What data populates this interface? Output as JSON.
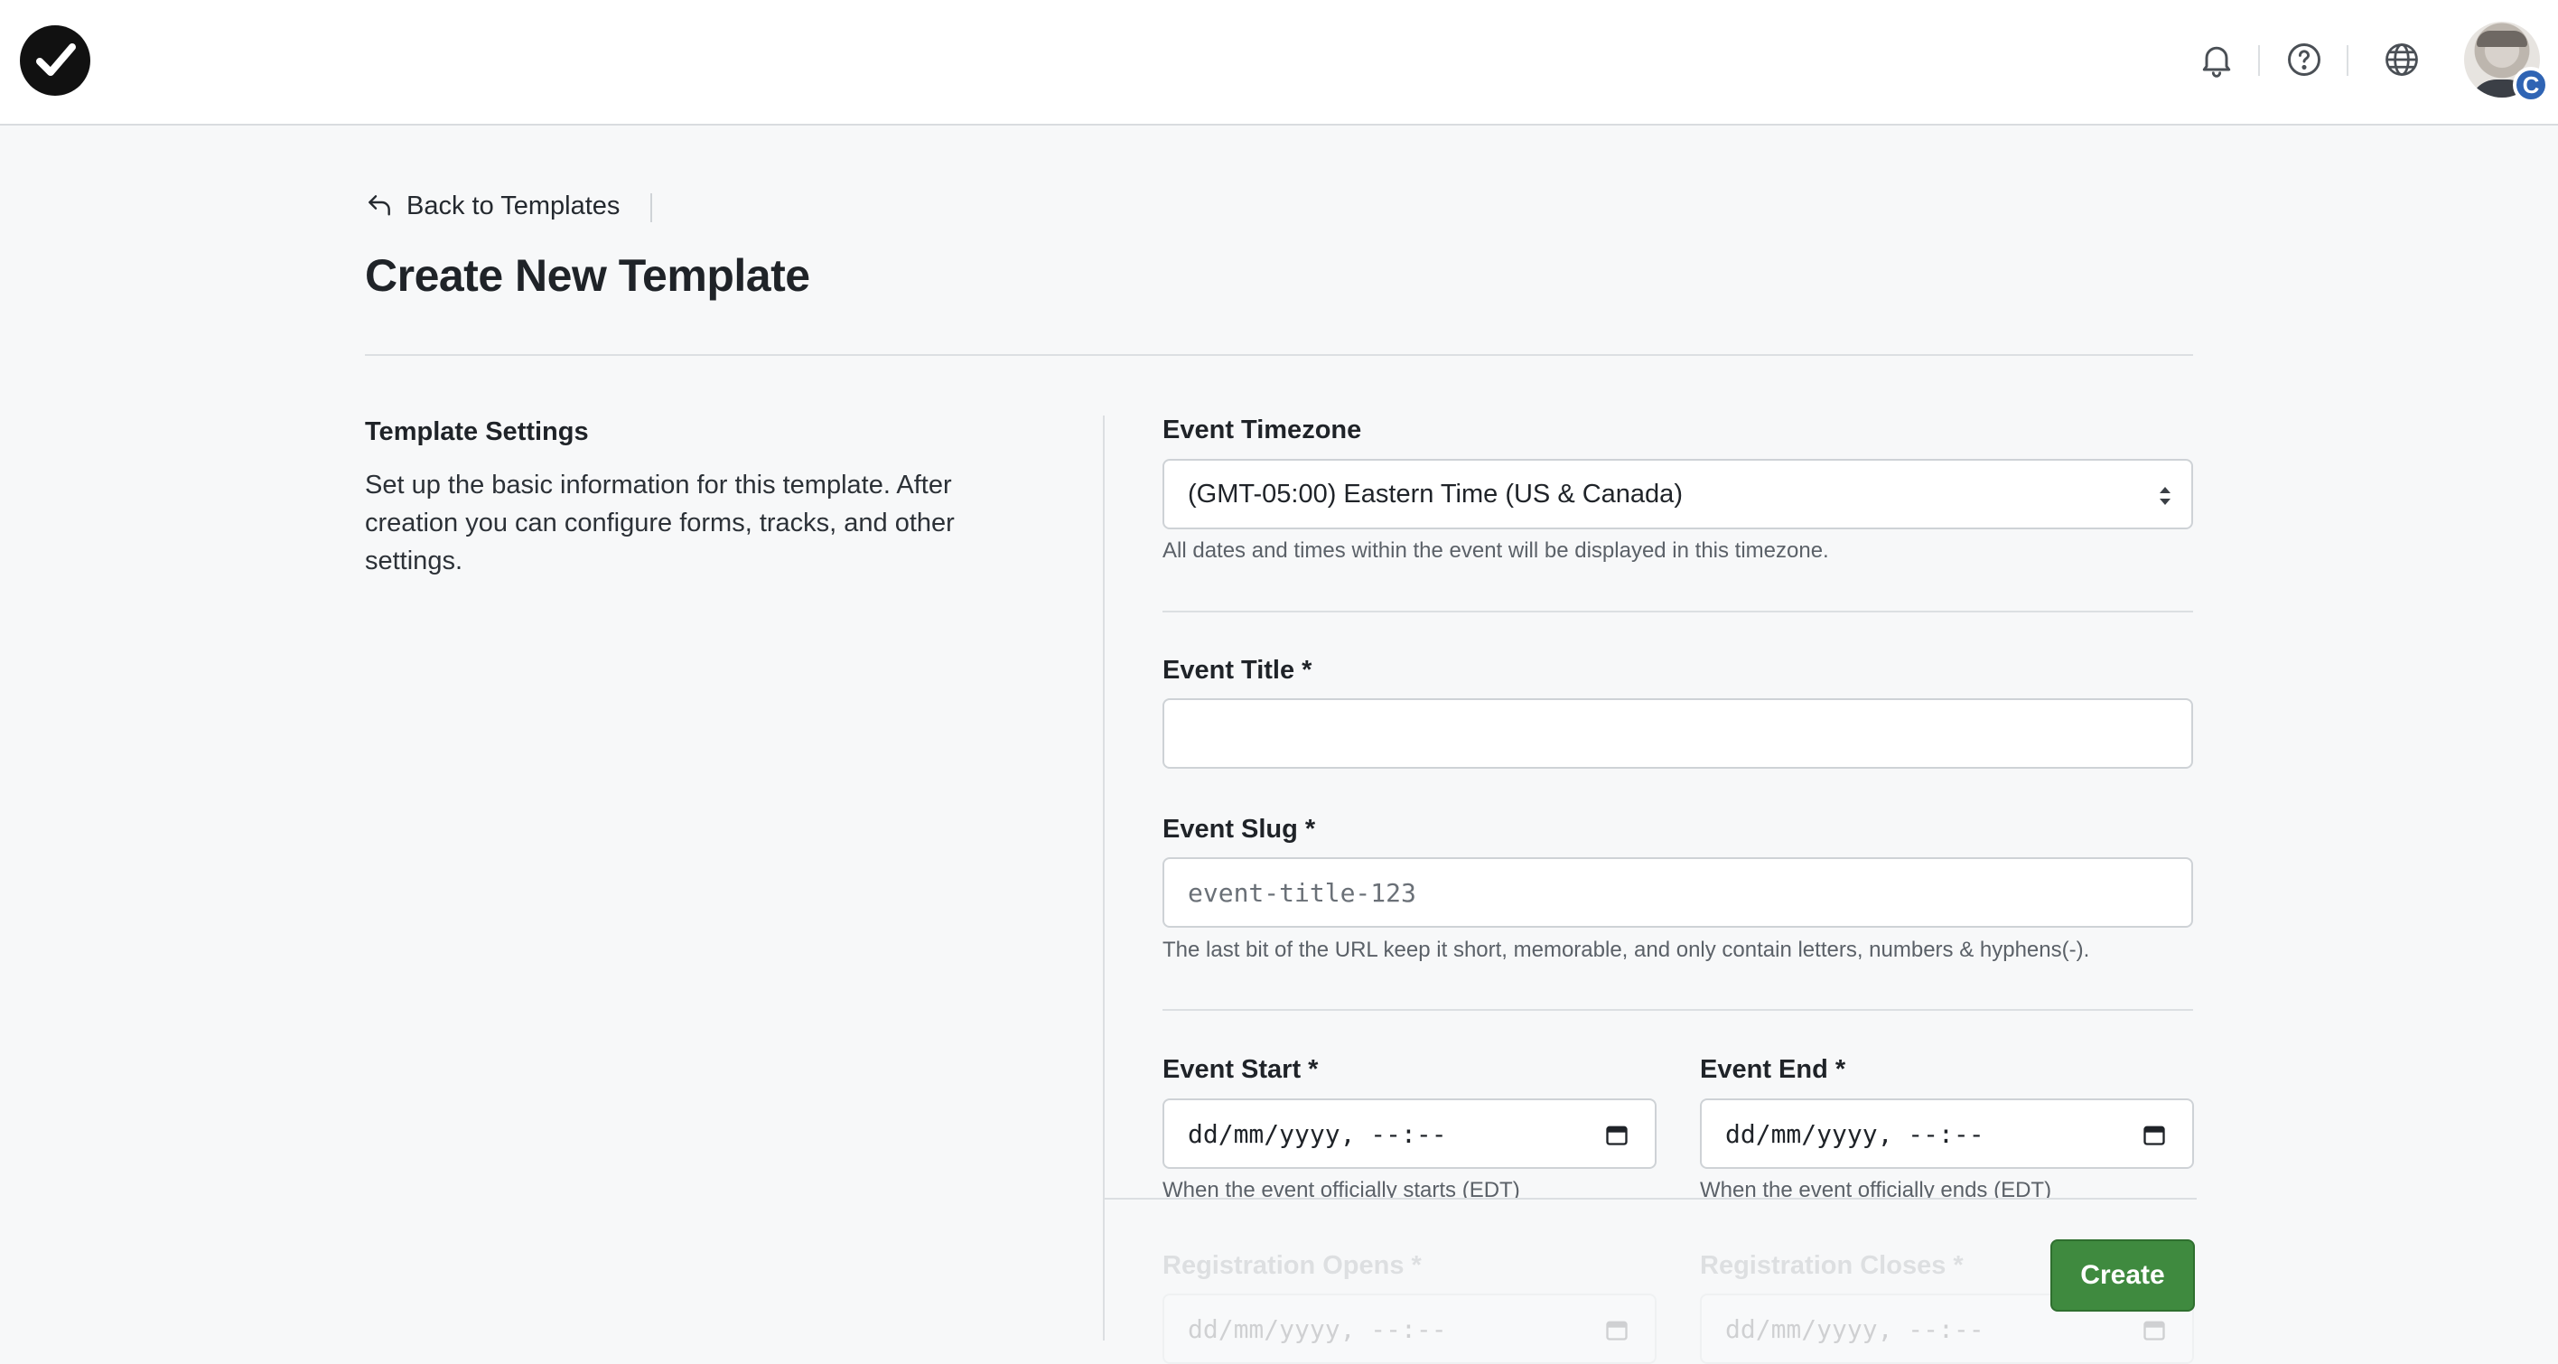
{
  "header": {
    "icons": [
      "logo-check-icon",
      "bell-icon",
      "help-icon",
      "globe-icon"
    ],
    "avatar_badge": "C"
  },
  "back_link": {
    "label": "Back to Templates"
  },
  "page": {
    "title": "Create New Template"
  },
  "left_panel": {
    "heading": "Template Settings",
    "description": "Set up the basic information for this template. After creation you can configure forms, tracks, and other settings."
  },
  "form": {
    "timezone": {
      "label": "Event Timezone",
      "value": "(GMT-05:00) Eastern Time (US & Canada)",
      "help": "All dates and times within the event will be displayed in this timezone."
    },
    "title": {
      "label": "Event Title *",
      "value": ""
    },
    "slug": {
      "label": "Event Slug *",
      "placeholder": "event-title-123",
      "help": "The last bit of the URL keep it short, memorable, and only contain letters, numbers & hyphens(-)."
    },
    "start": {
      "label": "Event Start *",
      "placeholder": "dd/mm/yyyy, --:--",
      "help": "When the event officially starts (EDT)"
    },
    "end": {
      "label": "Event End *",
      "placeholder": "dd/mm/yyyy, --:--",
      "help": "When the event officially ends (EDT)"
    },
    "reg_opens": {
      "label": "Registration Opens *",
      "placeholder": "dd/mm/yyyy, --:--"
    },
    "reg_closes": {
      "label": "Registration Closes *",
      "placeholder": "dd/mm/yyyy, --:--"
    }
  },
  "actions": {
    "create_label": "Create"
  },
  "colors": {
    "primary_button": "#3f8a3f",
    "badge": "#2f64b4"
  }
}
